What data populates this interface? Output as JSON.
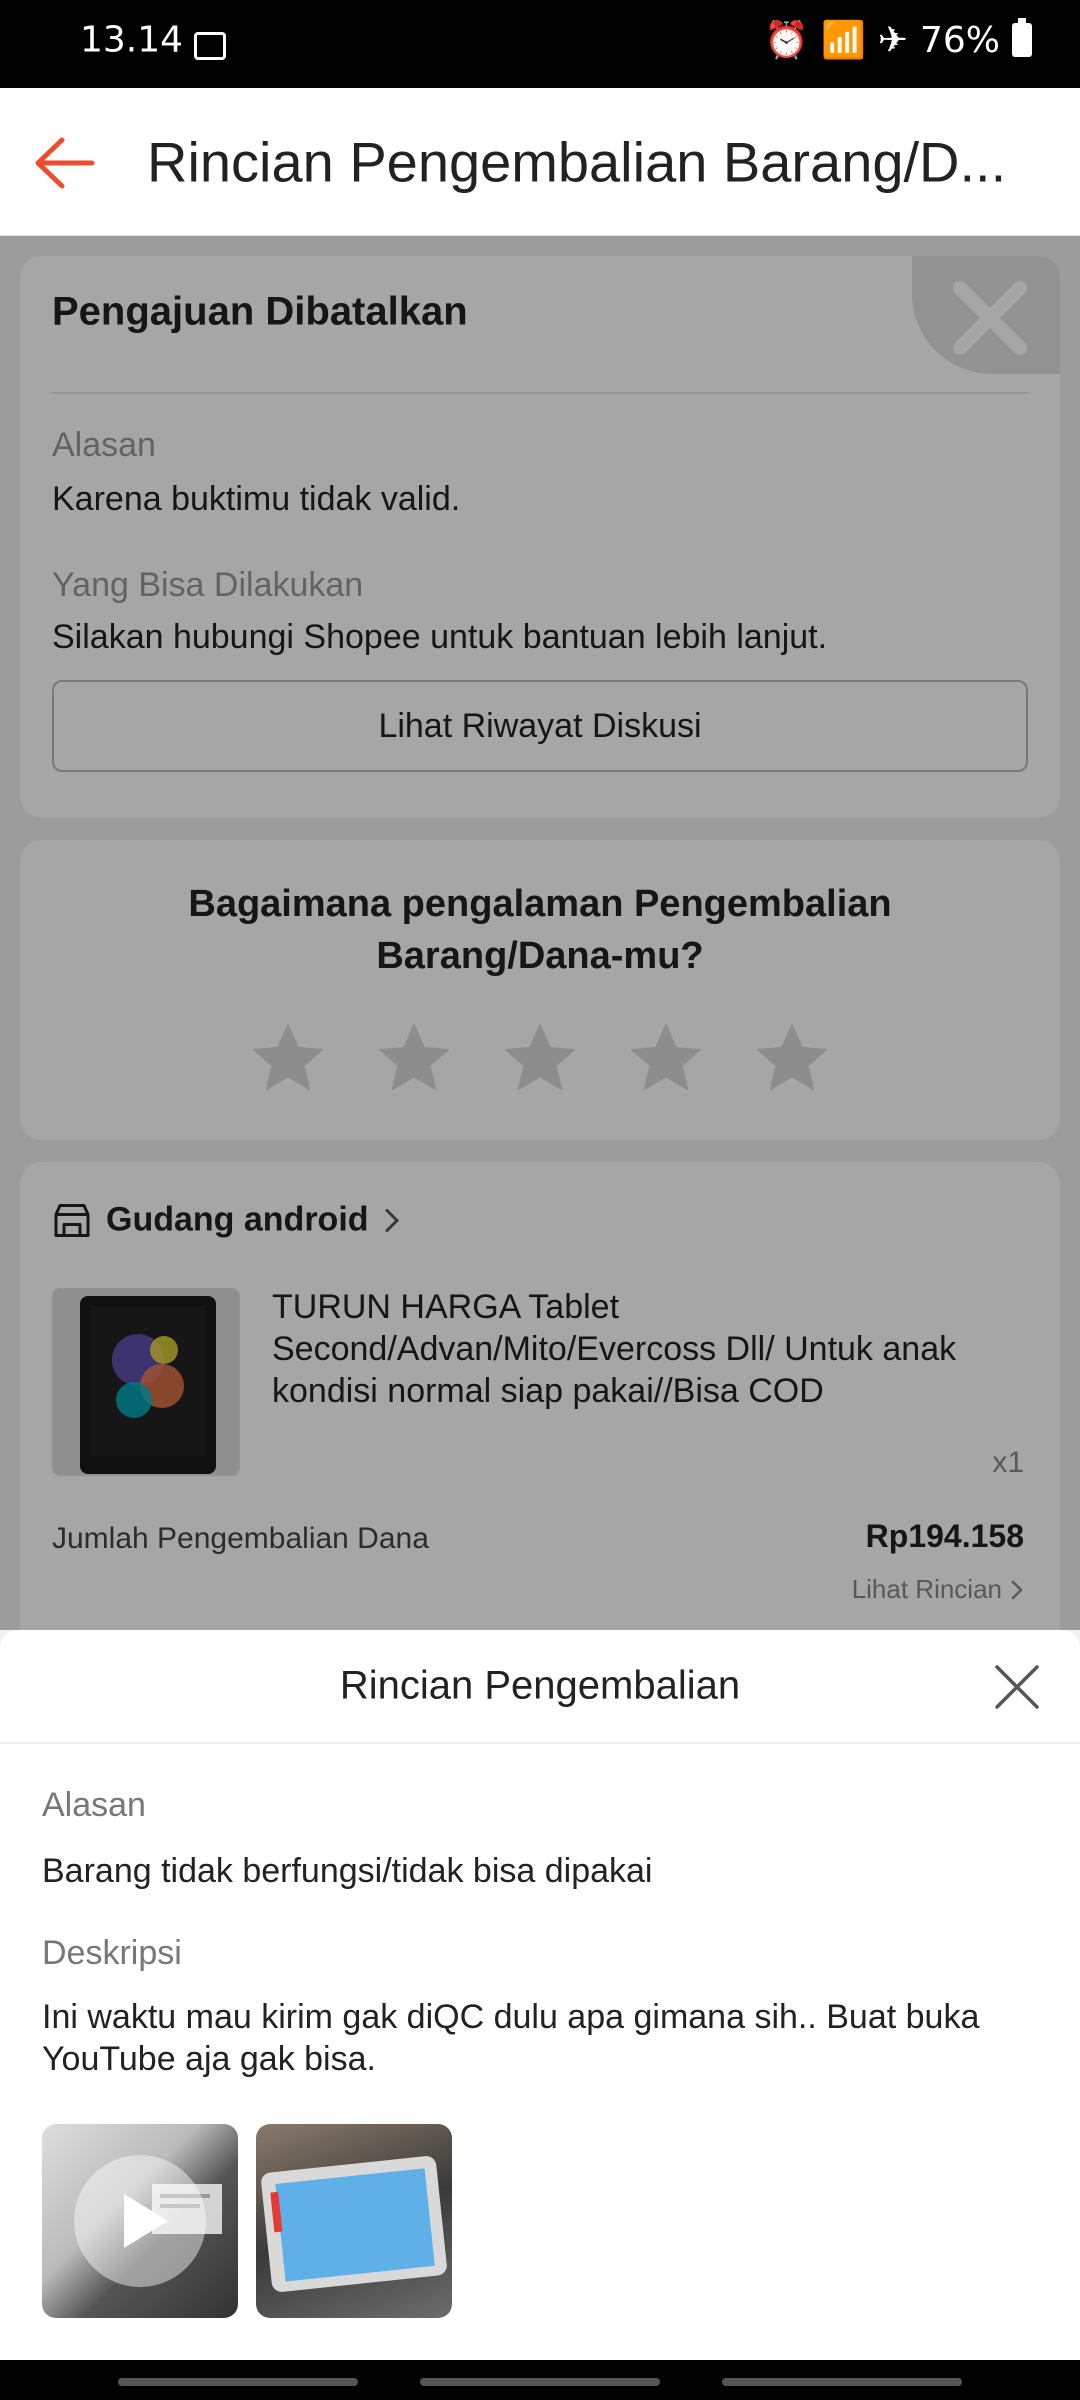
{
  "status": {
    "time": "13.14",
    "battery": "76%"
  },
  "header": {
    "title": "Rincian Pengembalian Barang/D..."
  },
  "status_card": {
    "title": "Pengajuan Dibatalkan",
    "reason_label": "Alasan",
    "reason_value": "Karena buktimu tidak valid.",
    "action_label": "Yang Bisa Dilakukan",
    "action_value": "Silakan hubungi Shopee untuk bantuan lebih lanjut.",
    "history_button": "Lihat Riwayat Diskusi"
  },
  "rating": {
    "question_line1": "Bagaimana pengalaman Pengembalian",
    "question_line2": "Barang/Dana-mu?",
    "stars": [
      0,
      0,
      0,
      0,
      0
    ]
  },
  "order": {
    "shop_name": "Gudang android",
    "product_name": "TURUN HARGA Tablet Second/Advan/Mito/Evercoss Dll/ Untuk anak kondisi normal siap pakai//Bisa COD",
    "quantity": "x1",
    "refund_label": "Jumlah Pengembalian Dana",
    "refund_amount": "Rp194.158",
    "details_link": "Lihat Rincian"
  },
  "sheet": {
    "title": "Rincian Pengembalian",
    "reason_label": "Alasan",
    "reason_value": "Barang tidak berfungsi/tidak bisa dipakai",
    "desc_label": "Deskripsi",
    "desc_value": "Ini waktu mau kirim gak diQC dulu apa gimana sih.. Buat buka YouTube aja gak bisa."
  },
  "colors": {
    "accent": "#ee4d2d",
    "overlay": "rgba(0,0,0,0.35)"
  }
}
